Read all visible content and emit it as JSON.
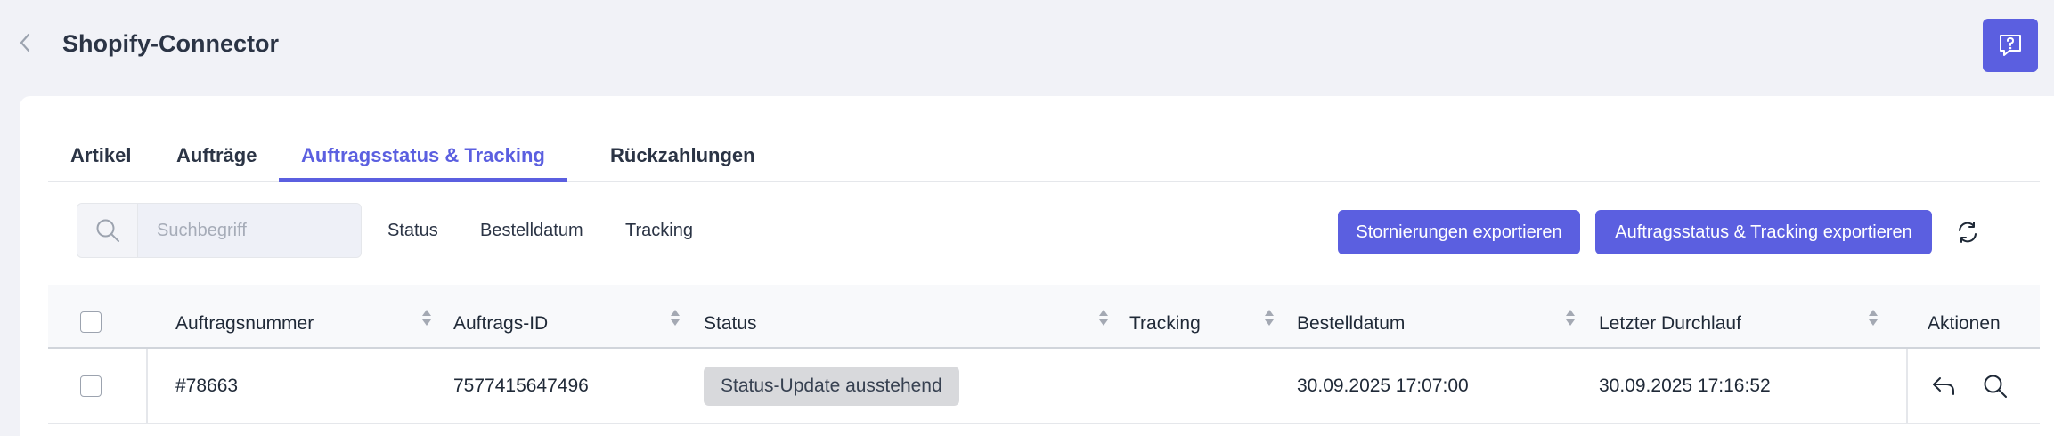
{
  "header": {
    "title": "Shopify-Connector"
  },
  "tabs": [
    {
      "label": "Artikel"
    },
    {
      "label": "Aufträge"
    },
    {
      "label": "Auftragsstatus & Tracking",
      "active": true
    },
    {
      "label": "Rückzahlungen"
    }
  ],
  "search": {
    "placeholder": "Suchbegriff",
    "value": ""
  },
  "filters": [
    "Status",
    "Bestelldatum",
    "Tracking"
  ],
  "actions": {
    "export_cancellations": "Stornierungen exportieren",
    "export_status_tracking": "Auftragsstatus & Tracking exportieren"
  },
  "table": {
    "columns": [
      "Auftragsnummer",
      "Auftrags-ID",
      "Status",
      "Tracking",
      "Bestelldatum",
      "Letzter Durchlauf",
      "Aktionen"
    ],
    "rows": [
      {
        "order_number": "#78663",
        "order_id": "7577415647496",
        "status": "Status-Update ausstehend",
        "tracking": "",
        "order_date": "30.09.2025 17:07:00",
        "last_run": "30.09.2025 17:16:52"
      }
    ]
  },
  "colors": {
    "accent": "#5b5fe0",
    "background": "#f1f2f7",
    "badge_bg": "#d8d9dc"
  },
  "icons": [
    "chevron-left-icon",
    "help-chat-icon",
    "search-icon",
    "refresh-icon",
    "sort-icon",
    "reply-icon",
    "magnifier-icon"
  ]
}
